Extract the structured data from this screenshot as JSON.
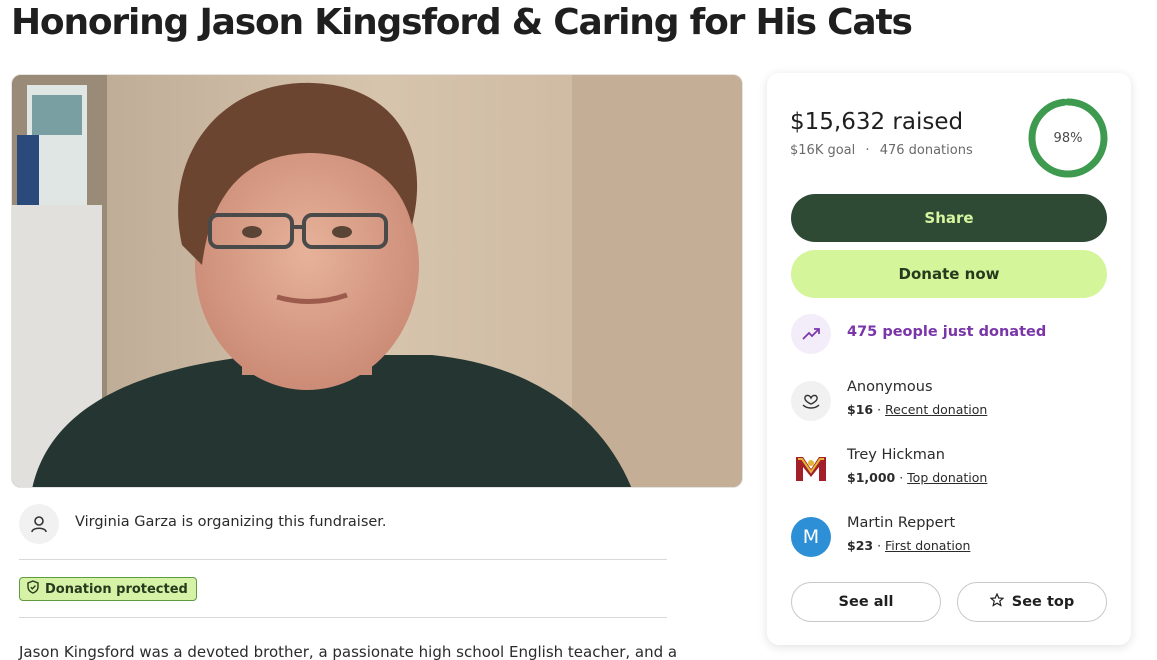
{
  "page": {
    "title": "Honoring Jason Kingsford & Caring for His Cats"
  },
  "photo": {
    "alt": "Photo of Jason Kingsford",
    "icon": "person-photo"
  },
  "organizer": {
    "text": "Virginia Garza is organizing this fundraiser.",
    "icon": "user-icon"
  },
  "badge": {
    "label": "Donation protected",
    "icon": "shield-icon"
  },
  "story": {
    "first_line": "Jason Kingsford was a devoted brother, a passionate high school English teacher, and a"
  },
  "donation_card": {
    "raised_text": "$15,632 raised",
    "goal_text": "$16K goal",
    "separator": "·",
    "donations_text": "476 donations",
    "progress_percent": 98,
    "progress_label": "98%",
    "share_label": "Share",
    "donate_label": "Donate now",
    "trend_text": "475 people just donated",
    "trend_icon": "trending-up-icon",
    "donors": [
      {
        "name": "Anonymous",
        "amount": "$16",
        "tag": "Recent donation",
        "avatar": "heart-hand-icon"
      },
      {
        "name": "Trey Hickman",
        "amount": "$1,000",
        "tag": "Top donation",
        "avatar": "crest-icon"
      },
      {
        "name": "Martin Reppert",
        "amount": "$23",
        "tag": "First donation",
        "avatar_letter": "M"
      }
    ],
    "see_all_label": "See all",
    "see_top_label": "See top",
    "see_top_icon": "star-icon"
  },
  "colors": {
    "share_bg": "#2e4a34",
    "donate_bg": "#d5f59b",
    "progress_green": "#3e9a4f",
    "trend_purple": "#7a35a8",
    "avatar_blue": "#2d8fd5"
  }
}
